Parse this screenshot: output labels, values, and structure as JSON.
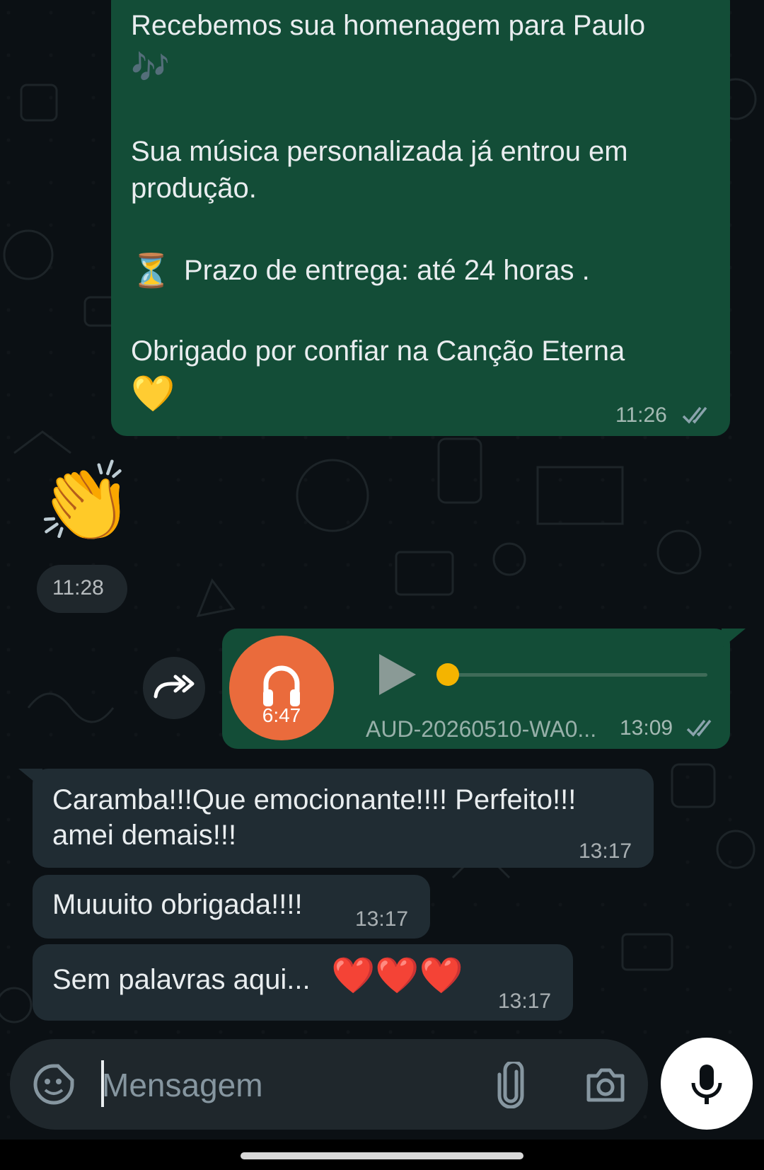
{
  "messages": {
    "confirmation": {
      "line1": "Recebemos sua homenagem para Paulo",
      "line2": "🎶",
      "line3": "Sua música personalizada já entrou em",
      "line4": "produção.",
      "line5_emoji": "⏳",
      "line5": "Prazo de entrega: até 24 horas .",
      "line6": "Obrigado por confiar na Canção Eterna",
      "line7": "💛",
      "time": "11:26",
      "status": "read"
    },
    "clap": {
      "emoji": "👏",
      "time": "11:28"
    },
    "audio": {
      "duration": "6:47",
      "filename": "AUD-20260510-WA0...",
      "time": "13:09",
      "status": "read",
      "progress": 0,
      "forwarded_icon": "forward-icon"
    },
    "reply1": {
      "line1": "Caramba!!!Que emocionante!!!! Perfeito!!!",
      "line2": "amei demais!!!",
      "time": "13:17"
    },
    "reply2": {
      "text": "Muuuito obrigada!!!!",
      "time": "13:17"
    },
    "reply3": {
      "text": "Sem palavras aqui...",
      "hearts": "❤️❤️❤️",
      "time": "13:17"
    }
  },
  "composer": {
    "placeholder": "Mensagem",
    "icons": [
      "sticker-icon",
      "attach-icon",
      "camera-icon",
      "mic-icon"
    ]
  },
  "colors": {
    "outgoing_bubble": "#134d37",
    "incoming_bubble": "#202c33",
    "background": "#0b1014",
    "audio_avatar": "#ea6b3c",
    "read_ticks": "#8aa3ac"
  }
}
